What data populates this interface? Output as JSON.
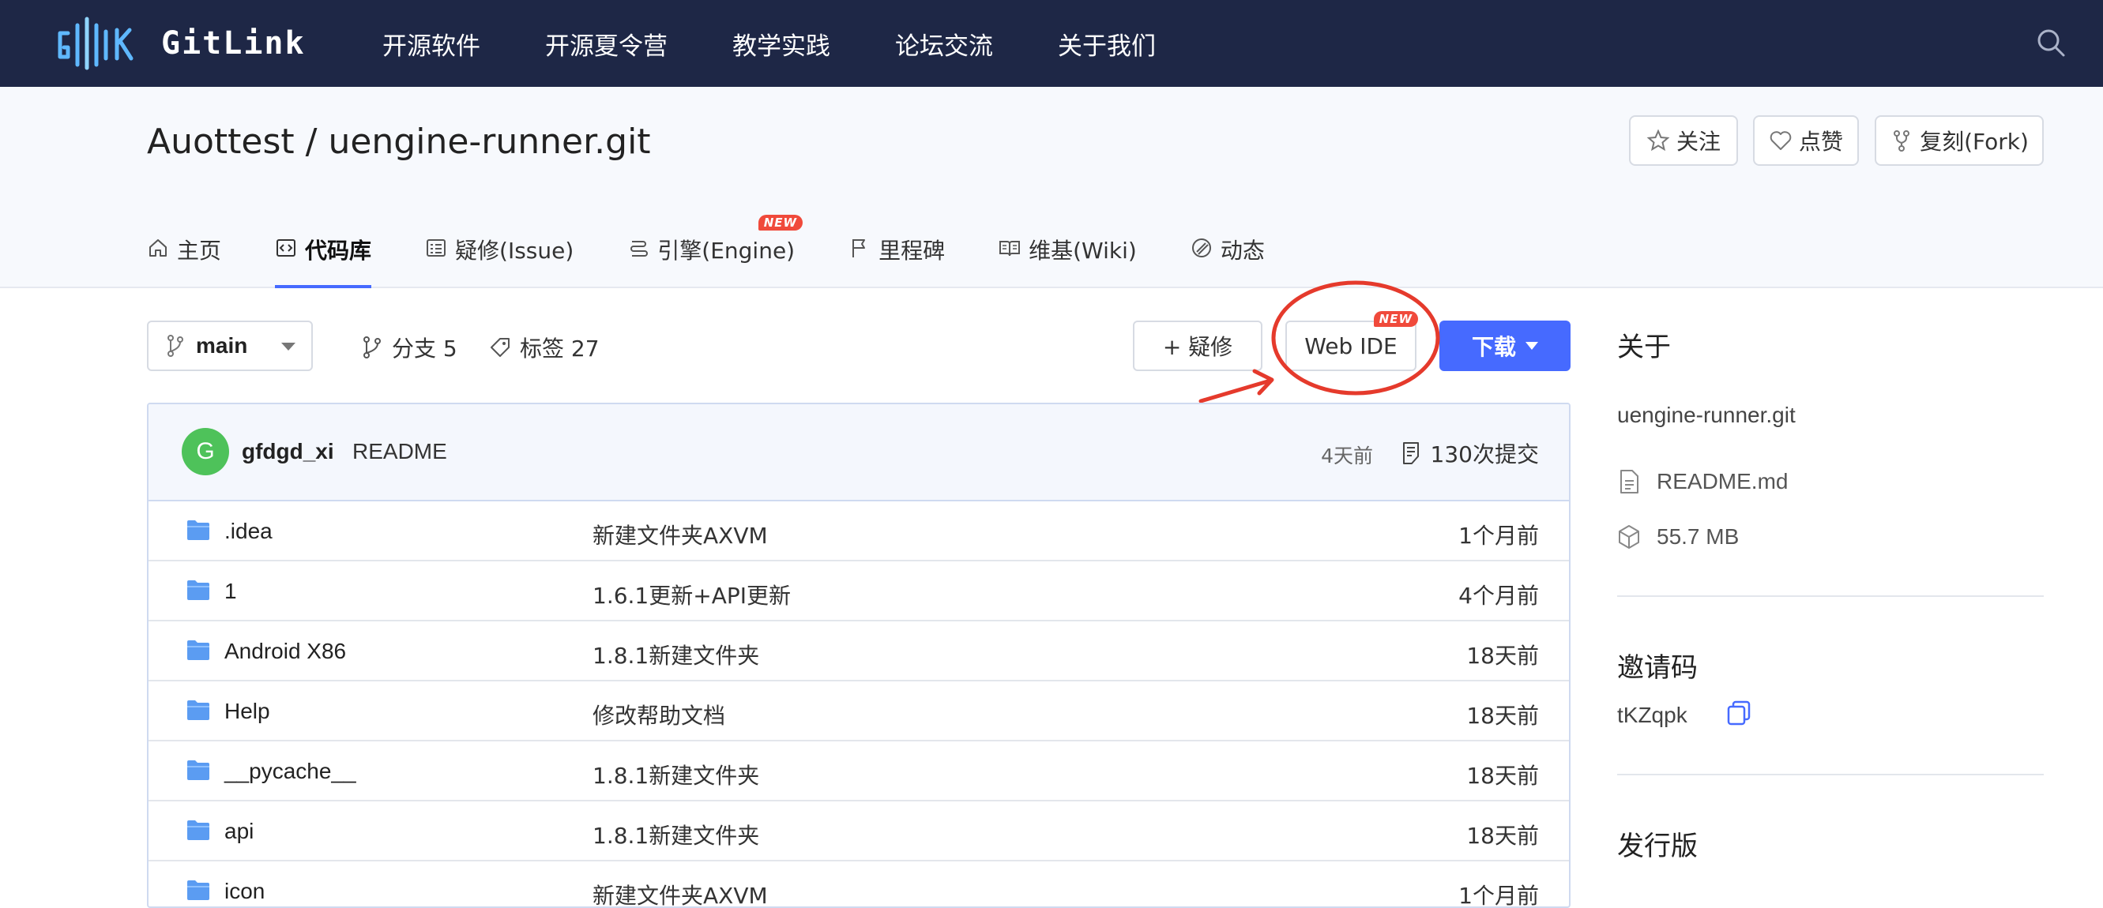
{
  "brand": {
    "name": "GitLink"
  },
  "nav": {
    "items": [
      "开源软件",
      "开源夏令营",
      "教学实践",
      "论坛交流",
      "关于我们"
    ]
  },
  "project": {
    "title": "Auottest / uengine-runner.git",
    "actions": {
      "watch": "关注",
      "star": "点赞",
      "fork": "复刻(Fork)"
    }
  },
  "tabs": [
    {
      "label": "主页",
      "icon": "home-icon"
    },
    {
      "label": "代码库",
      "icon": "code-icon",
      "active": true
    },
    {
      "label": "疑修(Issue)",
      "icon": "issue-icon"
    },
    {
      "label": "引擎(Engine)",
      "icon": "engine-icon",
      "badge": "NEW"
    },
    {
      "label": "里程碑",
      "icon": "flag-icon"
    },
    {
      "label": "维基(Wiki)",
      "icon": "book-icon"
    },
    {
      "label": "动态",
      "icon": "activity-icon"
    }
  ],
  "toolbar": {
    "branch": "main",
    "branches": "分支 5",
    "tags": "标签 27",
    "new_issue": "+ 疑修",
    "web_ide": "Web IDE",
    "web_ide_badge": "NEW",
    "download": "下载"
  },
  "commit": {
    "avatar_letter": "G",
    "user": "gfdgd_xi",
    "message": "README",
    "time": "4天前",
    "count": "130次提交"
  },
  "files": [
    {
      "name": ".idea",
      "message": "新建文件夹AXVM",
      "time": "1个月前"
    },
    {
      "name": "1",
      "message": "1.6.1更新+API更新",
      "time": "4个月前"
    },
    {
      "name": "Android X86",
      "message": "1.8.1新建文件夹",
      "time": "18天前"
    },
    {
      "name": "Help",
      "message": "修改帮助文档",
      "time": "18天前"
    },
    {
      "name": "__pycache__",
      "message": "1.8.1新建文件夹",
      "time": "18天前"
    },
    {
      "name": "api",
      "message": "1.8.1新建文件夹",
      "time": "18天前"
    },
    {
      "name": "icon",
      "message": "新建文件夹AXVM",
      "time": "1个月前"
    }
  ],
  "sidebar": {
    "about_title": "关于",
    "repo_name": "uengine-runner.git",
    "readme": "README.md",
    "size": "55.7 MB",
    "invite_title": "邀请码",
    "invite_code": "tKZqpk",
    "release_title": "发行版"
  },
  "colors": {
    "nav_bg": "#1e2746",
    "primary": "#466aff",
    "badge": "#f04a3b",
    "annotation": "#e53a2c"
  }
}
